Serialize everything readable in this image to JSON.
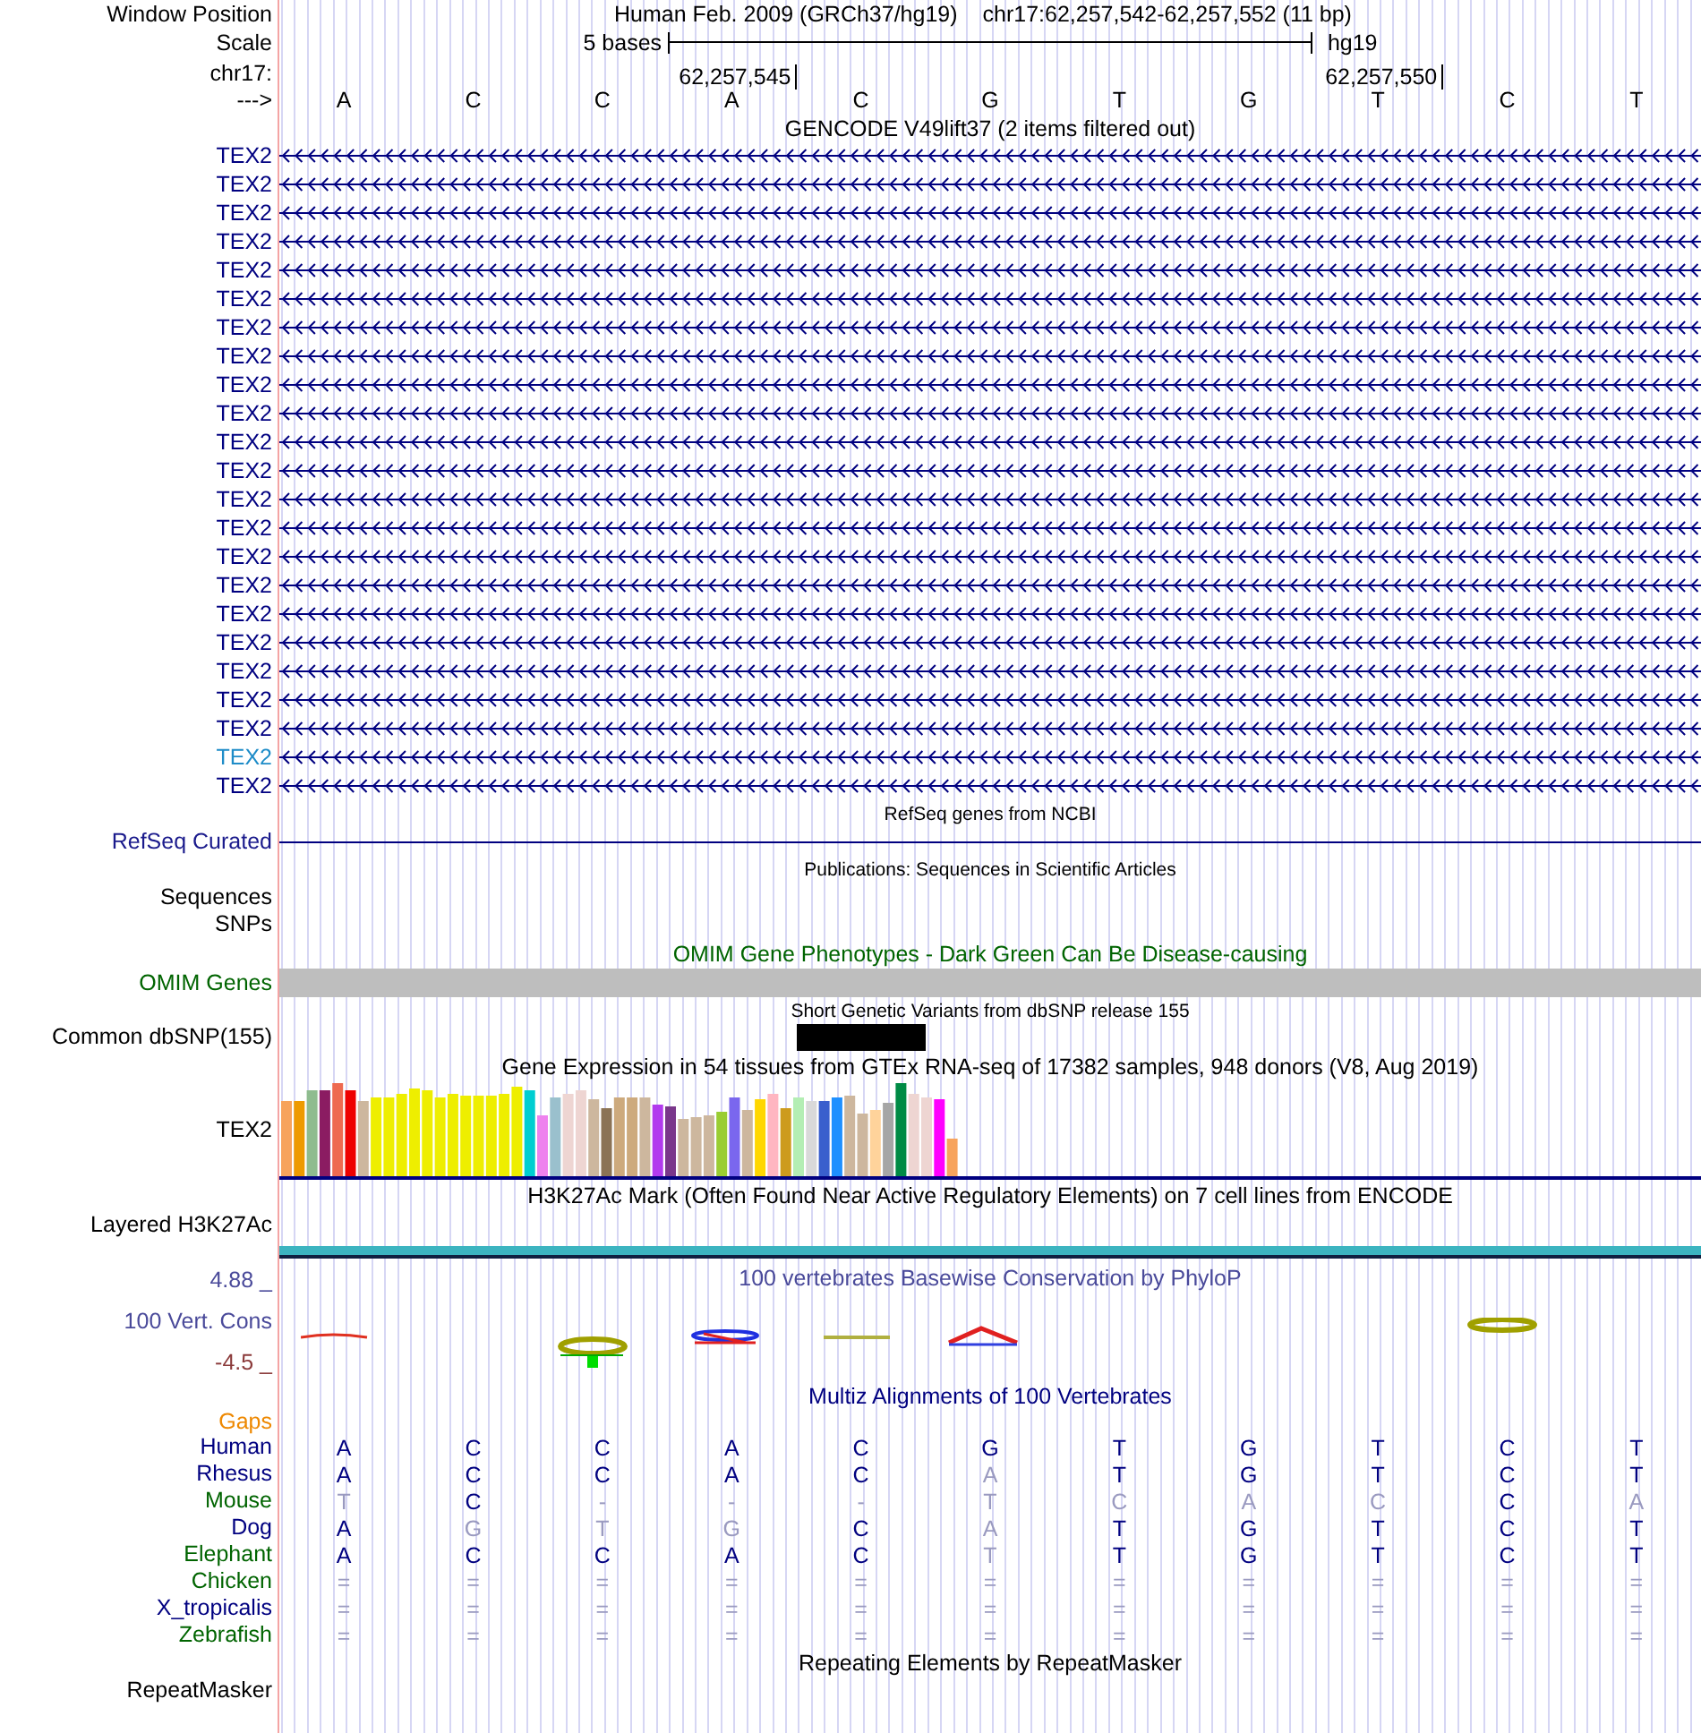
{
  "header": {
    "position_label": "Window Position",
    "assembly_text": "Human Feb. 2009 (GRCh37/hg19)",
    "range_text": "chr17:62,257,542-62,257,552 (11 bp)",
    "scale_label": "Scale",
    "scale_text": "5 bases",
    "scale_assembly": "hg19",
    "chrom_label": "chr17:",
    "coord_ticks": [
      "62,257,545",
      "62,257,550"
    ],
    "strand_label": "--->",
    "bases": [
      "A",
      "C",
      "C",
      "A",
      "C",
      "G",
      "T",
      "G",
      "T",
      "C",
      "T"
    ]
  },
  "tracks": [
    {
      "kind": "transcripts",
      "title": "GENCODE V49lift37 (2 items filtered out)",
      "rows": [
        {
          "label": "TEX2",
          "color": "#000080"
        },
        {
          "label": "TEX2",
          "color": "#000080"
        },
        {
          "label": "TEX2",
          "color": "#000080"
        },
        {
          "label": "TEX2",
          "color": "#000080"
        },
        {
          "label": "TEX2",
          "color": "#000080"
        },
        {
          "label": "TEX2",
          "color": "#000080"
        },
        {
          "label": "TEX2",
          "color": "#000080"
        },
        {
          "label": "TEX2",
          "color": "#000080"
        },
        {
          "label": "TEX2",
          "color": "#000080"
        },
        {
          "label": "TEX2",
          "color": "#000080"
        },
        {
          "label": "TEX2",
          "color": "#000080"
        },
        {
          "label": "TEX2",
          "color": "#000080"
        },
        {
          "label": "TEX2",
          "color": "#000080"
        },
        {
          "label": "TEX2",
          "color": "#000080"
        },
        {
          "label": "TEX2",
          "color": "#000080"
        },
        {
          "label": "TEX2",
          "color": "#000080"
        },
        {
          "label": "TEX2",
          "color": "#000080"
        },
        {
          "label": "TEX2",
          "color": "#000080"
        },
        {
          "label": "TEX2",
          "color": "#000080"
        },
        {
          "label": "TEX2",
          "color": "#000080"
        },
        {
          "label": "TEX2",
          "color": "#000080"
        },
        {
          "label": "TEX2",
          "color": "#1e8cc8"
        },
        {
          "label": "TEX2",
          "color": "#000080"
        }
      ]
    },
    {
      "kind": "line",
      "title": "RefSeq genes from NCBI",
      "label": "RefSeq Curated"
    },
    {
      "kind": "labels",
      "title": "Publications: Sequences in Scientific Articles",
      "labels": [
        "Sequences",
        "SNPs"
      ]
    },
    {
      "kind": "bar",
      "title": "OMIM Gene Phenotypes - Dark Green Can Be Disease-causing",
      "label": "OMIM Genes"
    },
    {
      "kind": "variant",
      "title": "Short Genetic Variants from dbSNP release 155",
      "label": "Common dbSNP(155)"
    },
    {
      "kind": "expression",
      "title": "Gene Expression in 54 tissues from GTEx RNA-seq of 17382 samples, 948 donors (V8, Aug 2019)",
      "label": "TEX2"
    },
    {
      "kind": "signal",
      "title": "H3K27Ac Mark (Often Found Near Active Regulatory Elements) on 7 cell lines from ENCODE",
      "label": "Layered H3K27Ac"
    },
    {
      "kind": "conservation",
      "title": "100 vertebrates Basewise Conservation by PhyloP",
      "label": "100 Vert. Cons",
      "axis_max": "4.88 _",
      "axis_min": "-4.5 _"
    },
    {
      "kind": "alignment",
      "title": "Multiz Alignments of 100 Vertebrates",
      "gaps_label": "Gaps",
      "species": [
        {
          "name": "Human",
          "color": "#000080",
          "bases": [
            "A",
            "C",
            "C",
            "A",
            "C",
            "G",
            "T",
            "G",
            "T",
            "C",
            "T"
          ],
          "dimmed": [
            false,
            false,
            false,
            false,
            false,
            false,
            false,
            false,
            false,
            false,
            false
          ]
        },
        {
          "name": "Rhesus",
          "color": "#000080",
          "bases": [
            "A",
            "C",
            "C",
            "A",
            "C",
            "A",
            "T",
            "G",
            "T",
            "C",
            "T"
          ],
          "dimmed": [
            false,
            false,
            false,
            false,
            false,
            true,
            false,
            false,
            false,
            false,
            false
          ]
        },
        {
          "name": "Mouse",
          "color": "#006400",
          "bases": [
            "T",
            "C",
            "-",
            "-",
            "-",
            "T",
            "C",
            "A",
            "C",
            "C",
            "A"
          ],
          "dimmed": [
            true,
            false,
            true,
            true,
            true,
            true,
            true,
            true,
            true,
            false,
            true
          ]
        },
        {
          "name": "Dog",
          "color": "#000080",
          "bases": [
            "A",
            "G",
            "T",
            "G",
            "C",
            "A",
            "T",
            "G",
            "T",
            "C",
            "T"
          ],
          "dimmed": [
            false,
            true,
            true,
            true,
            false,
            true,
            false,
            false,
            false,
            false,
            false
          ]
        },
        {
          "name": "Elephant",
          "color": "#006400",
          "bases": [
            "A",
            "C",
            "C",
            "A",
            "C",
            "T",
            "T",
            "G",
            "T",
            "C",
            "T"
          ],
          "dimmed": [
            false,
            false,
            false,
            false,
            false,
            true,
            false,
            false,
            false,
            false,
            false
          ]
        },
        {
          "name": "Chicken",
          "color": "#006400",
          "bases": [
            "=",
            "=",
            "=",
            "=",
            "=",
            "=",
            "=",
            "=",
            "=",
            "=",
            "="
          ],
          "dimmed": [
            true,
            true,
            true,
            true,
            true,
            true,
            true,
            true,
            true,
            true,
            true
          ]
        },
        {
          "name": "X_tropicalis",
          "color": "#000080",
          "bases": [
            "=",
            "=",
            "=",
            "=",
            "=",
            "=",
            "=",
            "=",
            "=",
            "=",
            "="
          ],
          "dimmed": [
            true,
            true,
            true,
            true,
            true,
            true,
            true,
            true,
            true,
            true,
            true
          ]
        },
        {
          "name": "Zebrafish",
          "color": "#006400",
          "bases": [
            "=",
            "=",
            "=",
            "=",
            "=",
            "=",
            "=",
            "=",
            "=",
            "=",
            "="
          ],
          "dimmed": [
            true,
            true,
            true,
            true,
            true,
            true,
            true,
            true,
            true,
            true,
            true
          ]
        }
      ]
    },
    {
      "kind": "repeats",
      "title": "Repeating Elements by RepeatMasker",
      "label": "RepeatMasker"
    }
  ]
}
